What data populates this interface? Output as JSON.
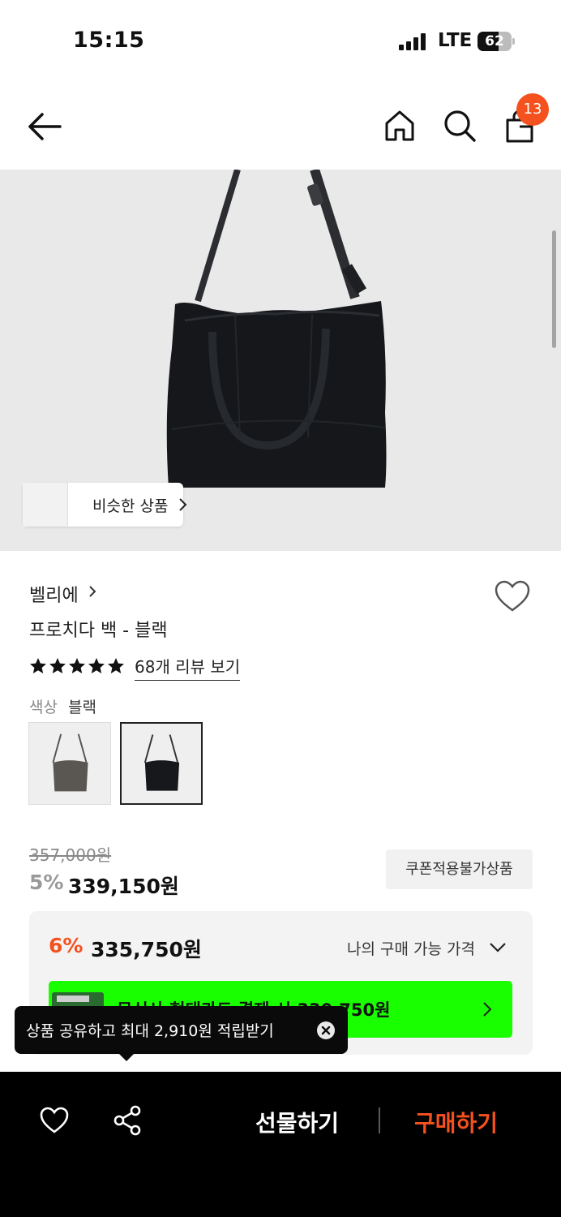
{
  "status_bar": {
    "time": "15:15",
    "network": "LTE",
    "battery": "62",
    "battery_level": 0.62
  },
  "header": {
    "cart_count": "13"
  },
  "gallery": {
    "similar_label": "비슷한 상품"
  },
  "product": {
    "brand": "벨리에",
    "name": "프로치다 백 - 블랙",
    "rating_stars": 5,
    "review_link": "68개 리뷰 보기",
    "color_label": "색상",
    "color_value": "블랙"
  },
  "pricing": {
    "original_price": "357,000원",
    "discount_rate": "5%",
    "sale_price": "339,150원",
    "coupon_badge": "쿠폰적용불가상품",
    "my_discount_rate": "6%",
    "my_price": "335,750원",
    "my_price_label": "나의 구매 가능 가격",
    "card_promo_text": "무신사 현대카드 결제 시 330,750원"
  },
  "tooltip": {
    "text": "상품 공유하고 최대 2,910원 적립받기"
  },
  "bottom_bar": {
    "gift_label": "선물하기",
    "buy_label": "구매하기"
  },
  "colors": {
    "accent": "#f4511e",
    "promo_green": "#1aff00",
    "bar_bg": "#000000"
  }
}
